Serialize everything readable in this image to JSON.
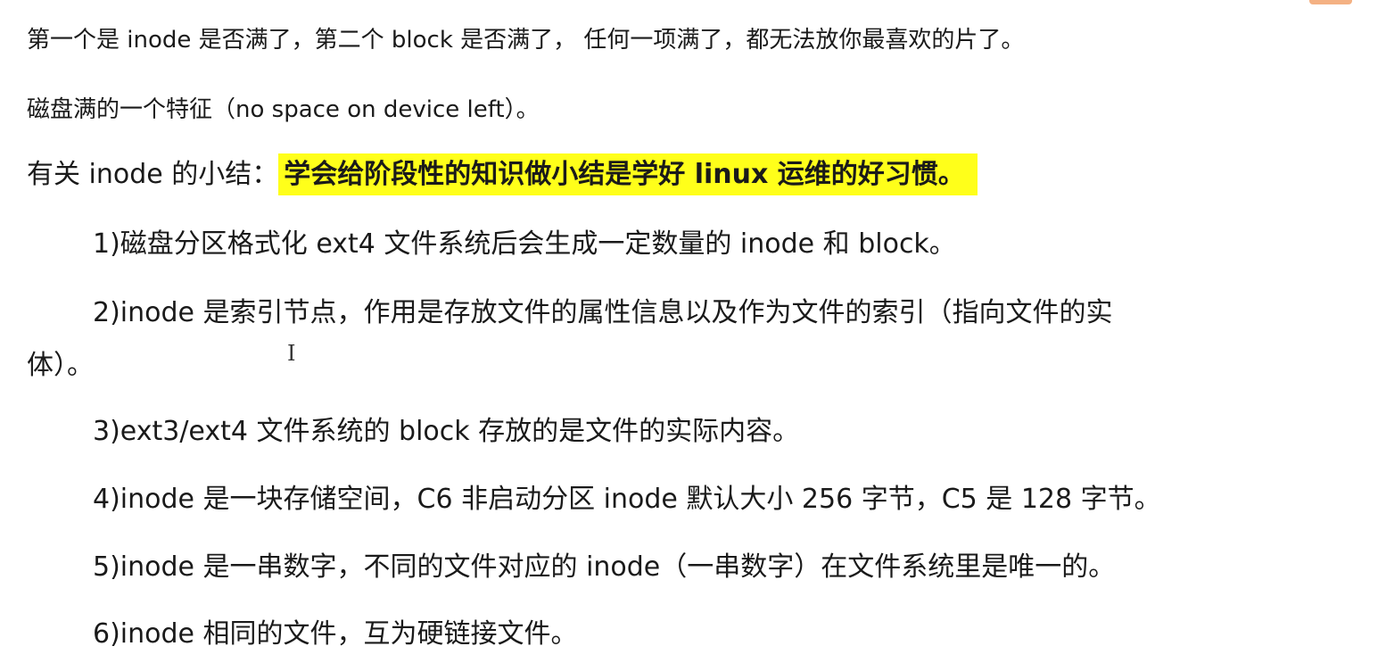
{
  "lines": {
    "line1": "第一个是 inode 是否满了，第二个 block 是否满了， 任何一项满了，都无法放你最喜欢的片了。",
    "line2": "磁盘满的一个特征（no space on device left）。",
    "line3_prefix": "有关 inode 的小结：",
    "line3_highlight": "学会给阶段性的知识做小结是学好 linux 运维的好习惯。"
  },
  "items": [
    "1)磁盘分区格式化 ext4 文件系统后会生成一定数量的 inode 和 block。",
    "2)inode 是索引节点，作用是存放文件的属性信息以及作为文件的索引（指向文件的实",
    "体）。",
    "3)ext3/ext4 文件系统的 block 存放的是文件的实际内容。",
    "4)inode 是一块存储空间，C6 非启动分区 inode 默认大小 256 字节，C5 是 128 字节。",
    "5)inode 是一串数字，不同的文件对应的 inode（一串数字）在文件系统里是唯一的。",
    "6)inode 相同的文件，互为硬链接文件。"
  ],
  "cursor_glyph": "I",
  "colors": {
    "highlight": "#ffff1a",
    "text": "#1a1a1a"
  }
}
